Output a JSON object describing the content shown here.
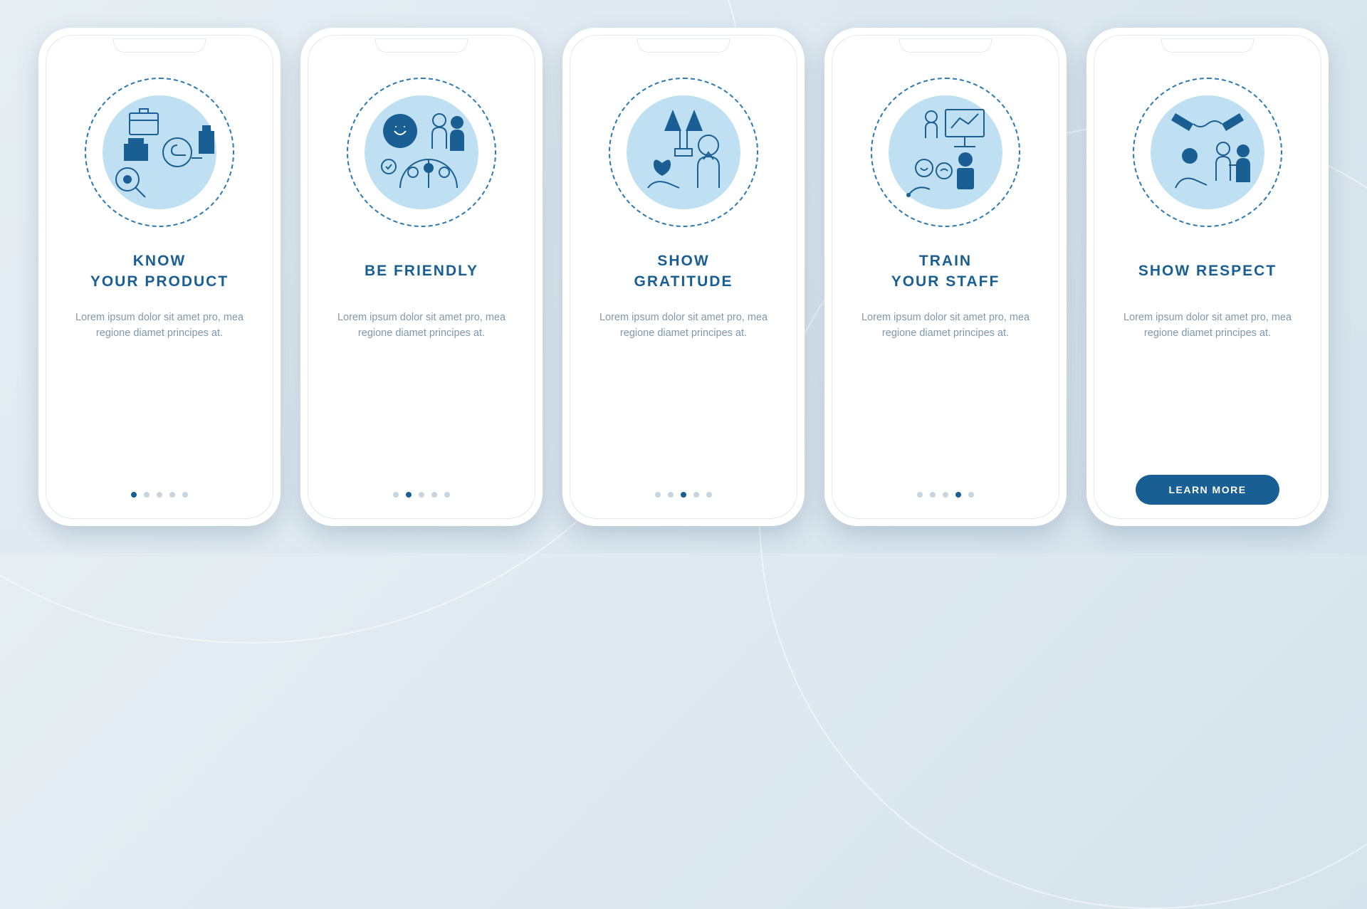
{
  "screens": [
    {
      "title": "KNOW\nYOUR PRODUCT",
      "desc": "Lorem ipsum dolor sit amet pro, mea regione diamet principes at.",
      "icon": "know-product",
      "active": 0
    },
    {
      "title": "BE FRIENDLY",
      "desc": "Lorem ipsum dolor sit amet pro, mea regione diamet principes at.",
      "icon": "be-friendly",
      "active": 1
    },
    {
      "title": "SHOW\nGRATITUDE",
      "desc": "Lorem ipsum dolor sit amet pro, mea regione diamet principes at.",
      "icon": "show-gratitude",
      "active": 2
    },
    {
      "title": "TRAIN\nYOUR STAFF",
      "desc": "Lorem ipsum dolor sit amet pro, mea regione diamet principes at.",
      "icon": "train-staff",
      "active": 3
    },
    {
      "title": "SHOW RESPECT",
      "desc": "Lorem ipsum dolor sit amet pro, mea regione diamet principes at.",
      "icon": "show-respect",
      "active": 4
    }
  ],
  "cta_label": "LEARN MORE",
  "total_screens": 5,
  "colors": {
    "primary": "#1a5f93",
    "accent": "#bfe0f2",
    "muted": "#8198aa"
  }
}
